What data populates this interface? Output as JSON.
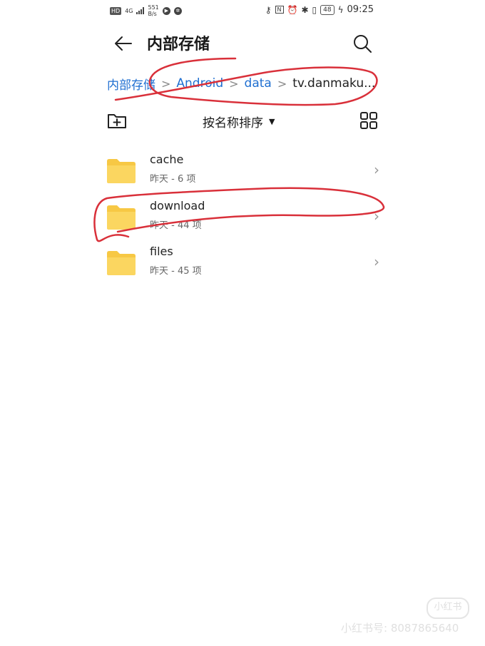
{
  "status_bar": {
    "hd": "HD",
    "network": "4G",
    "speed_value": "551",
    "speed_unit": "B/s",
    "battery": "48",
    "time": "09:25"
  },
  "header": {
    "title": "内部存储"
  },
  "breadcrumb": [
    {
      "label": "内部存储"
    },
    {
      "label": "Android"
    },
    {
      "label": "data"
    },
    {
      "label": "tv.danmaku..."
    }
  ],
  "toolbar": {
    "sort_label": "按名称排序"
  },
  "files": [
    {
      "name": "cache",
      "meta": "昨天 - 6 项"
    },
    {
      "name": "download",
      "meta": "昨天 - 44 项"
    },
    {
      "name": "files",
      "meta": "昨天 - 45 项"
    }
  ],
  "watermark": {
    "logo": "小红书",
    "text": "小红书号: 8087865640"
  },
  "colors": {
    "breadcrumb_link": "#1f6fd1",
    "folder": "#f7c844",
    "annotation": "#d9303a"
  }
}
